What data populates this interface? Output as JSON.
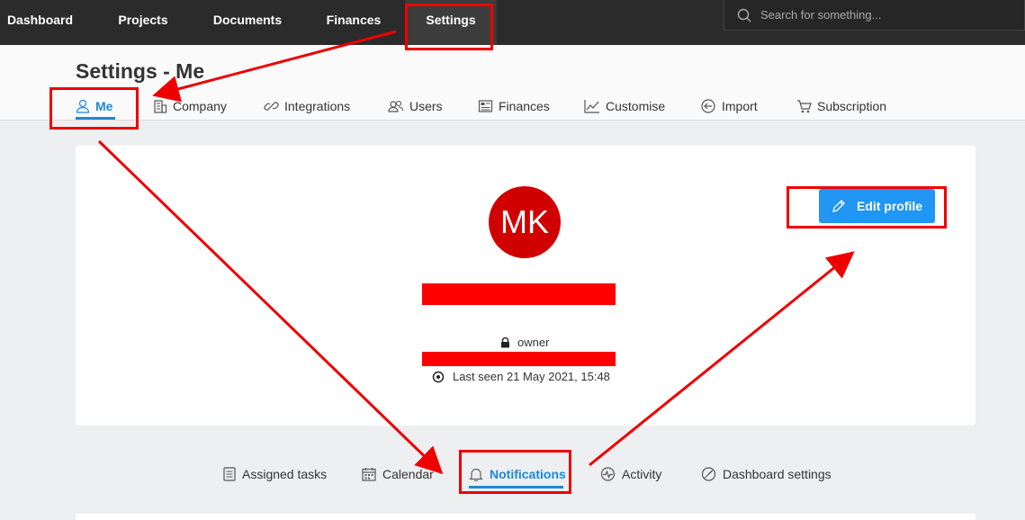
{
  "topnav": {
    "items": [
      {
        "label": "Dashboard"
      },
      {
        "label": "Projects"
      },
      {
        "label": "Documents"
      },
      {
        "label": "Finances"
      },
      {
        "label": "Settings",
        "active": true
      }
    ],
    "search_placeholder": "Search for something..."
  },
  "page": {
    "title": "Settings - Me"
  },
  "tabs": [
    {
      "label": "Me",
      "icon": "user-icon",
      "active": true
    },
    {
      "label": "Company",
      "icon": "building-icon"
    },
    {
      "label": "Integrations",
      "icon": "link-icon"
    },
    {
      "label": "Users",
      "icon": "users-icon"
    },
    {
      "label": "Finances",
      "icon": "finance-icon"
    },
    {
      "label": "Customise",
      "icon": "chart-icon"
    },
    {
      "label": "Import",
      "icon": "import-icon"
    },
    {
      "label": "Subscription",
      "icon": "cart-icon"
    }
  ],
  "profile": {
    "initials": "MK",
    "avatar_color": "#d10000",
    "role": "owner",
    "last_seen": "Last seen 21 May 2021, 15:48",
    "edit_label": "Edit profile"
  },
  "subtabs": [
    {
      "label": "Assigned tasks",
      "icon": "tasks-icon"
    },
    {
      "label": "Calendar",
      "icon": "calendar-icon"
    },
    {
      "label": "Notifications",
      "icon": "bell-icon",
      "active": true
    },
    {
      "label": "Activity",
      "icon": "activity-icon"
    },
    {
      "label": "Dashboard settings",
      "icon": "dashboard-icon"
    }
  ],
  "colors": {
    "accent": "#1e88d8",
    "button": "#2196f3",
    "annotation": "#ee0000",
    "topbar": "#2b2b2b"
  }
}
